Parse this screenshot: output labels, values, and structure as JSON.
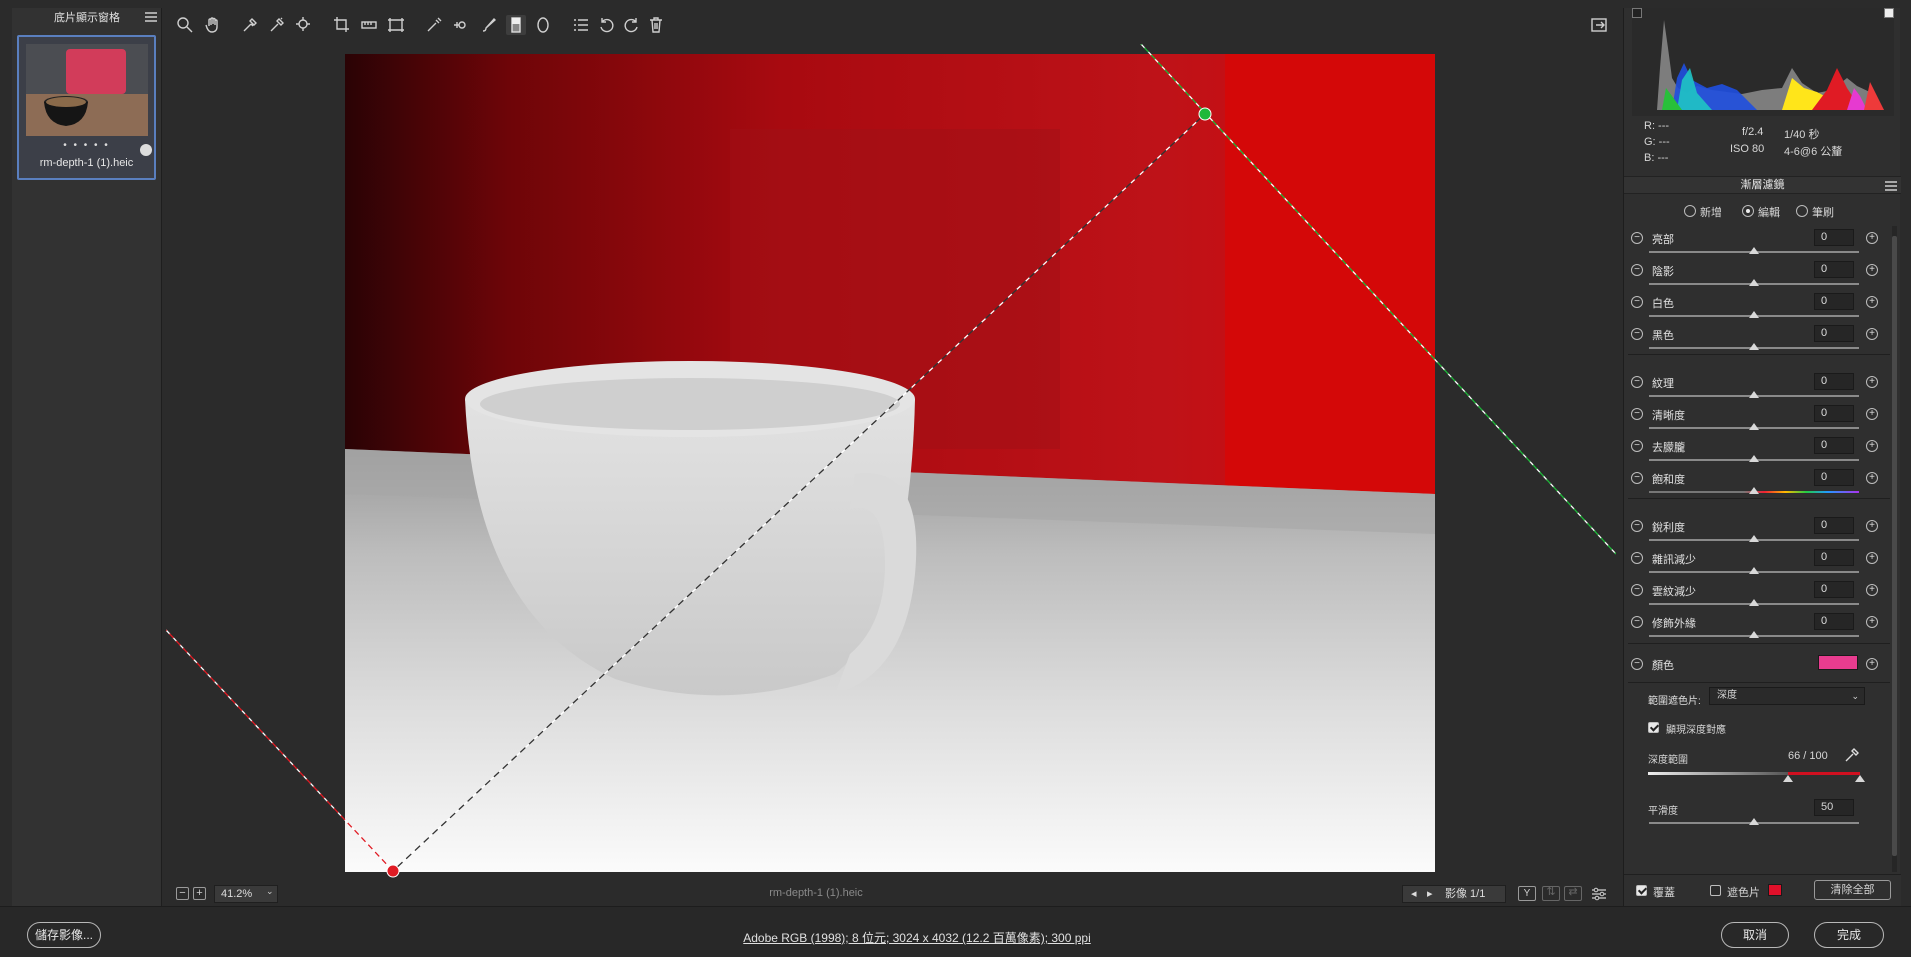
{
  "filmstrip": {
    "title": "底片顯示窗格",
    "thumbnail": {
      "dots": "• • • • •",
      "filename": "rm-depth-1 (1).heic"
    }
  },
  "toolbar": {
    "tools": [
      "zoom-icon",
      "hand-icon",
      "white-balance-icon",
      "color-sampler-icon",
      "target-adjust-icon",
      "crop-icon",
      "straighten-icon",
      "transform-icon",
      "spot-removal-icon",
      "red-eye-icon",
      "adjustment-brush-icon",
      "graduated-filter-icon",
      "radial-filter-icon",
      "presets-icon",
      "rotate-ccw-icon",
      "rotate-cw-icon",
      "trash-icon"
    ],
    "right_icon": "open-image-icon"
  },
  "canvas": {
    "colors": {
      "dark_red": "#3a0606",
      "red": "#b30a12",
      "bright_red": "#d40a0a",
      "table": "#f3f3f3",
      "cup": "#d9d9d9"
    },
    "guide_start_color": "#e01b24",
    "guide_end_color": "#1fb83a"
  },
  "canvasbar": {
    "zoom": "41.2%",
    "filename": "rm-depth-1 (1).heic",
    "image_counter": "影像 1/1",
    "right_buttons": [
      "Y",
      "before-after-icon",
      "swap-icon",
      "settings-icon"
    ]
  },
  "histogram": {
    "r": "R:  ---",
    "g": "G:  ---",
    "b": "B:  ---",
    "aperture": "f/2.4",
    "shutter": "1/40 秒",
    "iso": "ISO 80",
    "lens": "4-6@6 公釐"
  },
  "panel": {
    "title": "漸層濾鏡",
    "modes": [
      {
        "label": "新增",
        "selected": false
      },
      {
        "label": "編輯",
        "selected": true
      },
      {
        "label": "筆刷",
        "selected": false
      }
    ],
    "sliders": [
      {
        "label": "亮部",
        "value": "0"
      },
      {
        "label": "陰影",
        "value": "0"
      },
      {
        "label": "白色",
        "value": "0"
      },
      {
        "label": "黑色",
        "value": "0"
      },
      {
        "label": "紋理",
        "value": "0"
      },
      {
        "label": "清晰度",
        "value": "0"
      },
      {
        "label": "去朦朧",
        "value": "0"
      },
      {
        "label": "飽和度",
        "value": "0"
      },
      {
        "label": "銳利度",
        "value": "0"
      },
      {
        "label": "雜訊減少",
        "value": "0"
      },
      {
        "label": "雲紋減少",
        "value": "0"
      },
      {
        "label": "修飾外緣",
        "value": "0"
      }
    ],
    "color_label": "顏色",
    "color_swatch": "#e83c8f",
    "range_mask_label": "範圍遮色片:",
    "range_mask_value": "深度",
    "show_depth_label": "顯現深度對應",
    "show_depth_checked": true,
    "depth_range_label": "深度範圍",
    "depth_range_value": "66 / 100",
    "depth_range_low": 0.66,
    "smoothness_label": "平滑度",
    "smoothness_value": "50",
    "overlay_label": "覆蓋",
    "overlay_checked": true,
    "mask_label": "遮色片",
    "mask_checked": false,
    "mask_color": "#e0102a",
    "clear_all": "清除全部"
  },
  "footer": {
    "save": "儲存影像...",
    "info": "Adobe RGB (1998); 8 位元; 3024 x 4032 (12.2 百萬像素); 300 ppi",
    "cancel": "取消",
    "done": "完成"
  }
}
